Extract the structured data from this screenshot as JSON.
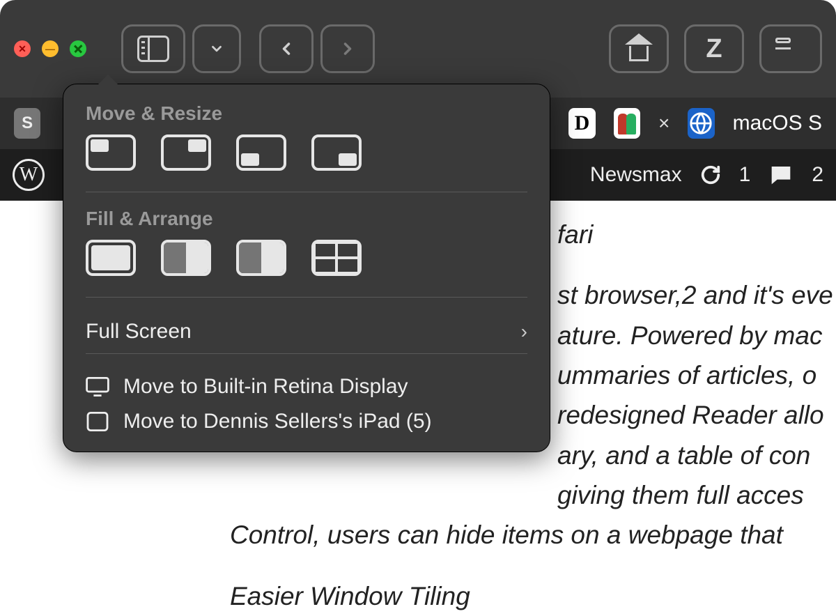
{
  "traffic_lights": {
    "close": "close",
    "minimize": "minimize",
    "zoom": "zoom"
  },
  "tabs": {
    "macos_tab_label": "macOS S",
    "close_glyph": "×"
  },
  "wpbar": {
    "newsmax": "Newsmax",
    "updates_count": "1",
    "comments_count": "2"
  },
  "page": {
    "line_fari": "fari",
    "line1": "st browser,2 and it's eve",
    "line2": "ature. Powered by mac",
    "line3": "ummaries of articles, o",
    "line4": "redesigned Reader allo",
    "line5": "ary, and a table of con",
    "line6": "giving them full acces",
    "line7": "Control, users can hide items on a webpage that",
    "heading": "Easier Window Tiling"
  },
  "popover": {
    "section_move_resize": "Move & Resize",
    "section_fill_arrange": "Fill & Arrange",
    "full_screen": "Full Screen",
    "move_builtin": "Move to Built-in Retina Display",
    "move_ipad": "Move to Dennis Sellers's iPad (5)"
  }
}
